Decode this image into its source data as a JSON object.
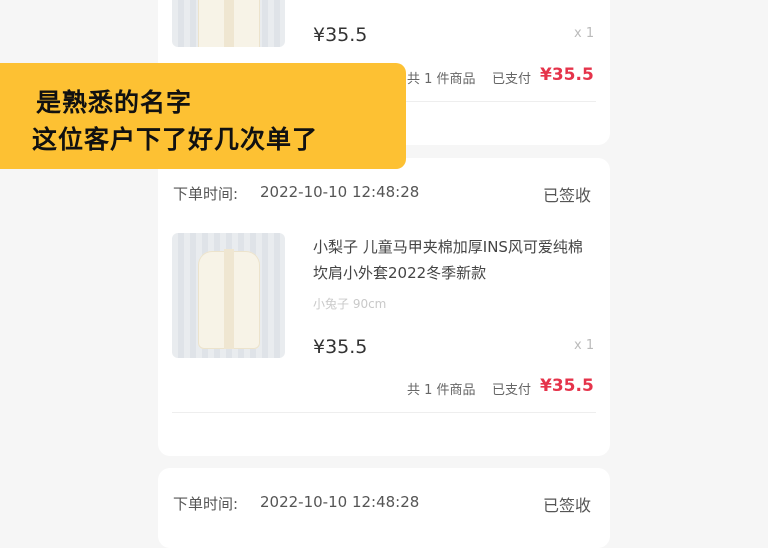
{
  "orders": [
    {
      "price": "¥35.5",
      "qty": "x 1",
      "summary_count": "共 1 件商品",
      "summary_paid_label": "已支付",
      "paid_amount": "¥35.5"
    },
    {
      "order_time_label": "下单时间:",
      "order_time": "2022-10-10 12:48:28",
      "status": "已签收",
      "title": "小梨子 儿童马甲夹棉加厚INS风可爱纯棉坎肩小外套2022冬季新款",
      "variant": "小兔子 90cm",
      "price": "¥35.5",
      "qty": "x 1",
      "summary_count": "共 1 件商品",
      "summary_paid_label": "已支付",
      "paid_amount": "¥35.5"
    },
    {
      "order_time_label": "下单时间:",
      "order_time": "2022-10-10 12:48:28",
      "status": "已签收"
    }
  ],
  "overlay": {
    "line1": "是熟悉的名字",
    "line2": "这位客户下了好几次单了"
  },
  "colors": {
    "background": "#f6f6f6",
    "card": "#ffffff",
    "accent_price": "#e5344b",
    "overlay_bg": "#fdc133"
  }
}
